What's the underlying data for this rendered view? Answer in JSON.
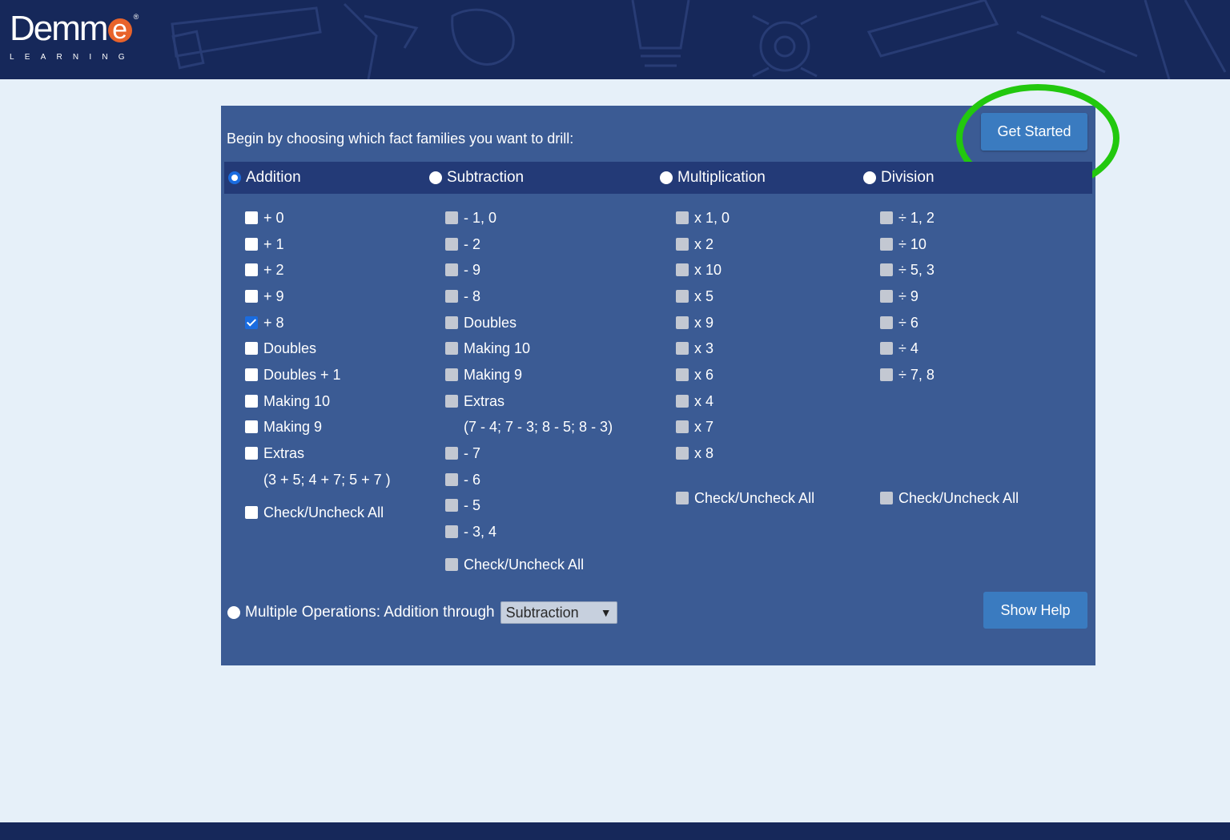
{
  "brand": {
    "name": "Demm",
    "name_accent": "e",
    "registered": "®",
    "tagline": "LEARNING"
  },
  "header": {
    "prompt": "Begin by choosing which fact families you want to drill:",
    "get_started_label": "Get Started"
  },
  "operations": [
    {
      "label": "Addition",
      "selected": false
    },
    {
      "label": "Subtraction",
      "selected": false
    },
    {
      "label": "Multiplication",
      "selected": false
    },
    {
      "label": "Division",
      "selected": false
    }
  ],
  "addition": {
    "items": [
      {
        "label": "+ 0",
        "checked": false
      },
      {
        "label": "+ 1",
        "checked": false
      },
      {
        "label": "+ 2",
        "checked": false
      },
      {
        "label": "+ 9",
        "checked": false
      },
      {
        "label": "+ 8",
        "checked": true
      },
      {
        "label": "Doubles",
        "checked": false
      },
      {
        "label": "Doubles + 1",
        "checked": false
      },
      {
        "label": "Making 10",
        "checked": false
      },
      {
        "label": "Making 9",
        "checked": false
      },
      {
        "label": "Extras",
        "checked": false
      }
    ],
    "extras_note": "(3 + 5; 4 + 7; 5 + 7 )",
    "check_all": "Check/Uncheck All"
  },
  "subtraction": {
    "items": [
      {
        "label": "- 1, 0"
      },
      {
        "label": "- 2"
      },
      {
        "label": "- 9"
      },
      {
        "label": "- 8"
      },
      {
        "label": "Doubles"
      },
      {
        "label": "Making 10"
      },
      {
        "label": "Making 9"
      },
      {
        "label": "Extras"
      }
    ],
    "extras_note": "(7 - 4; 7 - 3; 8 - 5; 8 - 3)",
    "items_after": [
      {
        "label": "- 7"
      },
      {
        "label": "- 6"
      },
      {
        "label": "- 5"
      },
      {
        "label": "- 3, 4"
      }
    ],
    "check_all": "Check/Uncheck All"
  },
  "multiplication": {
    "items": [
      {
        "label": "x 1, 0"
      },
      {
        "label": "x 2"
      },
      {
        "label": "x 10"
      },
      {
        "label": "x 5"
      },
      {
        "label": "x 9"
      },
      {
        "label": "x 3"
      },
      {
        "label": "x 6"
      },
      {
        "label": "x 4"
      },
      {
        "label": "x 7"
      },
      {
        "label": "x 8"
      }
    ],
    "check_all": "Check/Uncheck All"
  },
  "division": {
    "items": [
      {
        "label": "÷ 1, 2"
      },
      {
        "label": "÷ 10"
      },
      {
        "label": "÷ 5, 3"
      },
      {
        "label": "÷ 9"
      },
      {
        "label": "÷ 6"
      },
      {
        "label": "÷ 4"
      },
      {
        "label": "÷ 7, 8"
      }
    ],
    "check_all": "Check/Uncheck All"
  },
  "multi_ops": {
    "label": "Multiple Operations: Addition through",
    "selected_value": "Subtraction"
  },
  "help": {
    "label": "Show Help"
  },
  "colors": {
    "header_bg": "#16285a",
    "panel_bg": "#3b5b94",
    "ops_bar": "#233a77",
    "button": "#3a7bc0",
    "highlight_ring": "#22c80e",
    "brand_accent": "#e8632b"
  }
}
